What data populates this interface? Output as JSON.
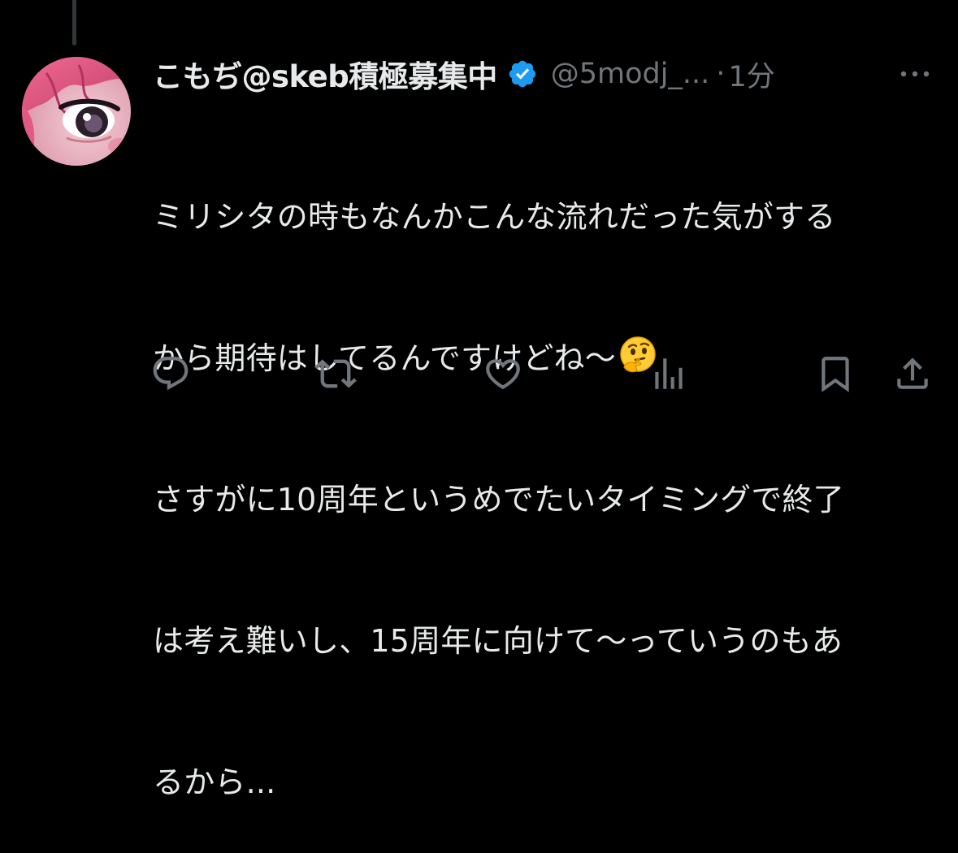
{
  "tweet": {
    "display_name": "こもぢ@skeb積極募集中",
    "handle": "@5modj_...",
    "separator": "·",
    "time": "1分",
    "text_lines": [
      "ミリシタの時もなんかこんな流れだった気がする",
      "から期待はしてるんですけどね〜",
      "さすがに10周年というめでたいタイミングで終了",
      "は考え難いし、15周年に向けて〜っていうのもあ",
      "るから..."
    ],
    "emoji": "thinking-face-emoji"
  },
  "icons": {
    "verified": "verified-badge-icon",
    "more": "more-options-icon",
    "reply": "reply-icon",
    "retweet": "retweet-icon",
    "like": "like-icon",
    "views": "views-icon",
    "bookmark": "bookmark-icon",
    "share": "share-icon"
  },
  "colors": {
    "background": "#000000",
    "primary_text": "#e7e9ea",
    "secondary_text": "#71767b",
    "verified_blue": "#1d9bf0"
  }
}
